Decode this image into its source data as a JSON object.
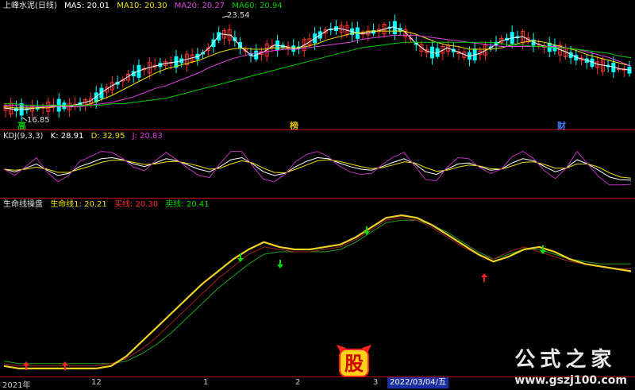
{
  "panel1": {
    "title": "上峰水泥(日线)",
    "ma_items": [
      {
        "label": "MA5: 20.01",
        "color": "#ffffff"
      },
      {
        "label": "MA10: 20.30",
        "color": "#f0e000"
      },
      {
        "label": "MA20: 20.27",
        "color": "#e040e0"
      },
      {
        "label": "MA60: 20.94",
        "color": "#00cc00"
      }
    ],
    "high_label": "23.54",
    "low_label": "16.85",
    "event_tags": [
      {
        "text": "高",
        "color": "#00c000"
      },
      {
        "text": "榜",
        "color": "#e0c000"
      },
      {
        "text": "财",
        "color": "#4080ff"
      }
    ]
  },
  "panel2": {
    "title": "KDJ(9,3,3)",
    "items": [
      {
        "label": "K: 28.91",
        "color": "#ffffff"
      },
      {
        "label": "D: 32.95",
        "color": "#f0e000"
      },
      {
        "label": "J: 20.83",
        "color": "#e040e0"
      }
    ]
  },
  "panel3": {
    "title": "生命线操盘",
    "items": [
      {
        "label": "生命线1: 20.21",
        "color": "#f0e000"
      },
      {
        "label": "买线: 20.30",
        "color": "#ff3030"
      },
      {
        "label": "卖线: 20.41",
        "color": "#00dd00"
      }
    ]
  },
  "xaxis": {
    "labels": [
      "2021年",
      "12",
      "1",
      "2",
      "3"
    ],
    "cursor_date": "2022/03/04/五"
  },
  "watermark": {
    "title": "公式之家",
    "url": "www.gszj100.com",
    "logo_char": "股"
  },
  "colors": {
    "up": "#ff3030",
    "down": "#00ffff",
    "grid": "#c00000",
    "life_line": "#f0d020",
    "buy_line": "#a02020",
    "sell_line": "#20a020"
  },
  "chart_data": {
    "type": "line",
    "panels": [
      {
        "name": "price",
        "type": "candlestick",
        "high": 23.54,
        "low": 16.85,
        "series": [
          {
            "name": "MA5",
            "values": [
              17.3,
              17.2,
              17.2,
              17.3,
              17.4,
              17.5,
              17.4,
              17.6,
              17.8,
              18.4,
              18.9,
              19.3,
              19.8,
              20.1,
              20.3,
              20.5,
              20.6,
              20.8,
              21.0,
              21.6,
              22.6,
              22.5,
              21.6,
              21.0,
              21.3,
              21.8,
              21.7,
              21.5,
              21.9,
              22.4,
              22.9,
              23.0,
              22.8,
              22.6,
              22.7,
              22.9,
              23.1,
              22.8,
              22.0,
              21.4,
              21.2,
              21.6,
              21.3,
              21.0,
              21.2,
              21.6,
              22.1,
              22.3,
              22.4,
              22.0,
              21.7,
              21.6,
              21.3,
              20.9,
              20.7,
              20.4,
              20.3,
              20.1,
              20.0
            ]
          },
          {
            "name": "MA10",
            "values": [
              17.4,
              17.3,
              17.3,
              17.3,
              17.3,
              17.4,
              17.4,
              17.4,
              17.6,
              17.9,
              18.2,
              18.6,
              19.0,
              19.4,
              19.8,
              20.1,
              20.3,
              20.5,
              20.7,
              21.0,
              21.3,
              21.5,
              21.6,
              21.5,
              21.5,
              21.6,
              21.6,
              21.6,
              21.7,
              21.9,
              22.2,
              22.4,
              22.6,
              22.7,
              22.8,
              22.8,
              22.8,
              22.8,
              22.6,
              22.3,
              22.0,
              21.8,
              21.7,
              21.5,
              21.5,
              21.5,
              21.6,
              21.8,
              22.0,
              22.1,
              22.0,
              21.8,
              21.6,
              21.4,
              21.1,
              20.9,
              20.7,
              20.5,
              20.3
            ]
          },
          {
            "name": "MA20",
            "values": [
              17.5,
              17.5,
              17.4,
              17.4,
              17.4,
              17.4,
              17.4,
              17.4,
              17.5,
              17.6,
              17.7,
              17.9,
              18.1,
              18.4,
              18.7,
              18.9,
              19.2,
              19.5,
              19.8,
              20.2,
              20.5,
              20.8,
              21.0,
              21.2,
              21.3,
              21.4,
              21.5,
              21.5,
              21.6,
              21.7,
              21.8,
              21.9,
              22.0,
              22.2,
              22.3,
              22.4,
              22.5,
              22.5,
              22.5,
              22.4,
              22.3,
              22.2,
              22.1,
              22.0,
              21.9,
              21.8,
              21.7,
              21.7,
              21.7,
              21.7,
              21.7,
              21.7,
              21.6,
              21.5,
              21.3,
              21.1,
              20.9,
              20.6,
              20.3
            ]
          },
          {
            "name": "MA60",
            "values": [
              17.6,
              17.6,
              17.5,
              17.5,
              17.5,
              17.5,
              17.5,
              17.5,
              17.5,
              17.5,
              17.6,
              17.6,
              17.7,
              17.8,
              17.9,
              18.0,
              18.2,
              18.4,
              18.6,
              18.8,
              19.0,
              19.2,
              19.4,
              19.6,
              19.8,
              20.0,
              20.2,
              20.4,
              20.6,
              20.8,
              21.0,
              21.2,
              21.4,
              21.6,
              21.7,
              21.8,
              21.9,
              22.0,
              22.0,
              22.0,
              22.0,
              22.0,
              22.0,
              22.0,
              22.0,
              22.0,
              21.9,
              21.8,
              21.8,
              21.7,
              21.7,
              21.6,
              21.6,
              21.5,
              21.4,
              21.3,
              21.2,
              21.0,
              20.9
            ]
          }
        ]
      },
      {
        "name": "KDJ(9,3,3)",
        "ylim": [
          0,
          100
        ],
        "series": [
          {
            "name": "K",
            "values": [
              50,
              45,
              52,
              60,
              48,
              38,
              42,
              55,
              62,
              70,
              72,
              68,
              60,
              55,
              62,
              70,
              66,
              58,
              50,
              45,
              55,
              68,
              72,
              60,
              45,
              38,
              42,
              55,
              65,
              72,
              70,
              62,
              55,
              50,
              48,
              55,
              63,
              70,
              60,
              45,
              40,
              50,
              60,
              62,
              55,
              48,
              50,
              62,
              70,
              66,
              55,
              45,
              52,
              68,
              60,
              48,
              35,
              30,
              29
            ]
          },
          {
            "name": "D",
            "values": [
              50,
              48,
              50,
              54,
              50,
              44,
              44,
              50,
              56,
              63,
              67,
              67,
              63,
              59,
              60,
              64,
              65,
              61,
              56,
              50,
              52,
              60,
              66,
              62,
              52,
              44,
              43,
              50,
              58,
              66,
              68,
              65,
              60,
              55,
              51,
              53,
              58,
              64,
              62,
              53,
              46,
              48,
              54,
              58,
              56,
              51,
              50,
              56,
              63,
              64,
              59,
              52,
              52,
              60,
              60,
              54,
              43,
              35,
              33
            ]
          },
          {
            "name": "J",
            "values": [
              50,
              38,
              55,
              72,
              44,
              26,
              38,
              65,
              74,
              84,
              82,
              70,
              54,
              47,
              66,
              82,
              68,
              52,
              38,
              34,
              61,
              84,
              84,
              56,
              31,
              26,
              40,
              65,
              78,
              84,
              74,
              56,
              45,
              40,
              42,
              59,
              73,
              82,
              56,
              30,
              28,
              54,
              72,
              70,
              53,
              42,
              50,
              74,
              84,
              70,
              47,
              32,
              52,
              84,
              60,
              36,
              20,
              20,
              21
            ]
          }
        ]
      },
      {
        "name": "生命线操盘",
        "series": [
          {
            "name": "生命线1",
            "values": [
              17.2,
              17.1,
              17.1,
              17.1,
              17.1,
              17.1,
              17.1,
              17.2,
              17.6,
              18.2,
              18.8,
              19.4,
              20.0,
              20.6,
              21.1,
              21.6,
              22.0,
              22.3,
              22.1,
              22.0,
              22.0,
              22.1,
              22.2,
              22.5,
              22.9,
              23.3,
              23.4,
              23.3,
              23.0,
              22.6,
              22.2,
              21.8,
              21.5,
              21.7,
              22.0,
              22.1,
              21.9,
              21.6,
              21.4,
              21.3,
              21.2,
              21.1
            ]
          },
          {
            "name": "买线",
            "values": [
              17.3,
              17.2,
              17.2,
              17.2,
              17.2,
              17.2,
              17.2,
              17.3,
              17.5,
              17.9,
              18.4,
              19.0,
              19.6,
              20.2,
              20.8,
              21.3,
              21.8,
              22.1,
              22.0,
              21.9,
              21.9,
              22.0,
              22.1,
              22.4,
              22.8,
              23.2,
              23.3,
              23.2,
              22.9,
              22.5,
              22.1,
              21.8,
              21.6,
              21.9,
              22.1,
              21.9,
              21.7,
              21.5,
              21.4,
              21.3,
              21.2,
              21.2
            ]
          },
          {
            "name": "卖线",
            "values": [
              17.4,
              17.3,
              17.3,
              17.3,
              17.3,
              17.3,
              17.3,
              17.3,
              17.4,
              17.7,
              18.1,
              18.6,
              19.2,
              19.8,
              20.4,
              20.9,
              21.4,
              21.8,
              21.9,
              21.9,
              21.9,
              21.9,
              22.0,
              22.3,
              22.7,
              23.1,
              23.2,
              23.2,
              23.0,
              22.7,
              22.3,
              21.9,
              21.6,
              21.8,
              22.0,
              22.0,
              21.8,
              21.6,
              21.5,
              21.4,
              21.4,
              21.4
            ]
          }
        ]
      }
    ]
  }
}
